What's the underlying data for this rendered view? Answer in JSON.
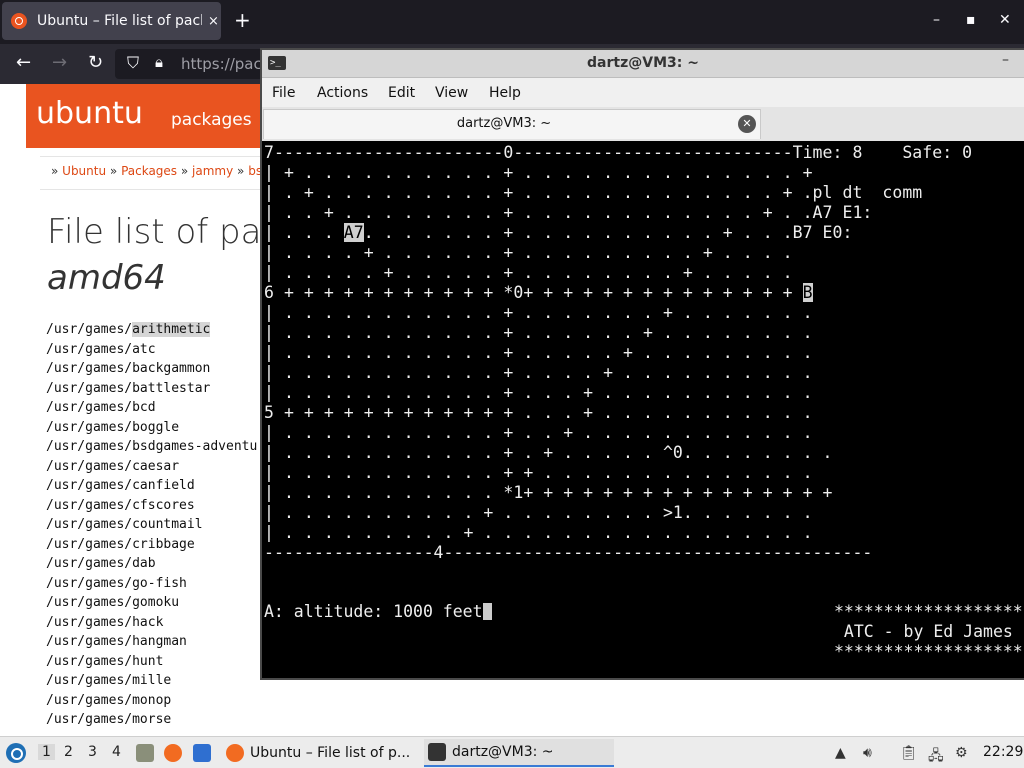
{
  "firefox": {
    "tab_title": "Ubuntu – File list of package",
    "tab_close": "×",
    "new_tab": "+",
    "url": "https://pack",
    "window_controls": {
      "minimize": "–",
      "maximize": "▪",
      "close": "✕"
    },
    "page": {
      "logo": "ubuntu",
      "logo_suffix": "packages",
      "breadcrumb": [
        "Ubuntu",
        "Packages",
        "jammy",
        "bsdg"
      ],
      "title": "File list of pac",
      "subtitle": "amd64",
      "files": [
        {
          "prefix": "/usr/games/",
          "name": "arithmetic",
          "highlight": true
        },
        {
          "prefix": "/usr/games/",
          "name": "atc"
        },
        {
          "prefix": "/usr/games/",
          "name": "backgammon"
        },
        {
          "prefix": "/usr/games/",
          "name": "battlestar"
        },
        {
          "prefix": "/usr/games/",
          "name": "bcd"
        },
        {
          "prefix": "/usr/games/",
          "name": "boggle"
        },
        {
          "prefix": "/usr/games/",
          "name": "bsdgames-adventu"
        },
        {
          "prefix": "/usr/games/",
          "name": "caesar"
        },
        {
          "prefix": "/usr/games/",
          "name": "canfield"
        },
        {
          "prefix": "/usr/games/",
          "name": "cfscores"
        },
        {
          "prefix": "/usr/games/",
          "name": "countmail"
        },
        {
          "prefix": "/usr/games/",
          "name": "cribbage"
        },
        {
          "prefix": "/usr/games/",
          "name": "dab"
        },
        {
          "prefix": "/usr/games/",
          "name": "go-fish"
        },
        {
          "prefix": "/usr/games/",
          "name": "gomoku"
        },
        {
          "prefix": "/usr/games/",
          "name": "hack"
        },
        {
          "prefix": "/usr/games/",
          "name": "hangman"
        },
        {
          "prefix": "/usr/games/",
          "name": "hunt"
        },
        {
          "prefix": "/usr/games/",
          "name": "mille"
        },
        {
          "prefix": "/usr/games/",
          "name": "monop"
        },
        {
          "prefix": "/usr/games/",
          "name": "morse"
        }
      ]
    }
  },
  "terminal": {
    "window_title": "dartz@VM3: ~",
    "menu": [
      "File",
      "Actions",
      "Edit",
      "View",
      "Help"
    ],
    "tab_title": "dartz@VM3: ~",
    "atc_screen": [
      "7-----------------------0----------------------------Time: 8    Safe: 0",
      "| + . . . . . . . . . . + . . . . . . . . . . . . . . +",
      "| . + . . . . . . . . . + . . . . . . . . . . . . . + .pl dt  comm",
      "| . . + . . . . . . . . + . . . . . . . . . . . . + . .A7 E1:",
      "| . . . [A7]. . . . . . . + . . . . . . . . . . + . . .B7 E0:",
      "| . . . . + . . . . . . + . . . . . . . . . + . . . .",
      "| . . . . . + . . . . . + . . . . . . . . + . . . . .",
      "6 + + + + + + + + + + + *0+ + + + + + + + + + + + + + [B]",
      "| . . . . . . . . . . . + . . . . . . . + . . . . . . .",
      "| . . . . . . . . . . . + . . . . . . + . . . . . . . .",
      "| . . . . . . . . . . . + . . . . . + . . . . . . . . .",
      "| . . . . . . . . . . . + . . . . + . . . . . . . . . .",
      "| . . . . . . . . . . . + . . . + . . . . . . . . . . .",
      "5 + + + + + + + + + + + + . . . + . . . . . . . . . . .",
      "| . . . . . . . . . . . + . . + . . . . . . . . . . . .",
      "| . . . . . . . . . . . + . + . . . . . ^0. . . . . . . .",
      "| . . . . . . . . . . . + + . . . . . . . . . . . . . .",
      "| . . . . . . . . . . . *1+ + + + + + + + + + + + + + + +",
      "| . . . . . . . . . . + . . . . . . . . >1. . . . . . .",
      "| . . . . . . . . . + . . . . . . . . . . . . . . . . .",
      "-----------------4-------------------------------------------"
    ],
    "status_line": "A: altitude: 1000 feet",
    "credit": [
      "*********************",
      " ATC - by Ed James",
      "*********************"
    ]
  },
  "taskbar": {
    "workspaces": [
      "1",
      "2",
      "3",
      "4"
    ],
    "active_workspace": "1",
    "tasks": [
      {
        "label": "Ubuntu – File list of p...",
        "icon": "firefox-icon"
      },
      {
        "label": "dartz@VM3: ~",
        "icon": "terminal-icon",
        "active": true
      }
    ],
    "clock": "22:29"
  },
  "colors": {
    "ubuntu_orange": "#e95420",
    "terminal_bg": "#000000",
    "ff_chrome": "#1c1b22"
  }
}
